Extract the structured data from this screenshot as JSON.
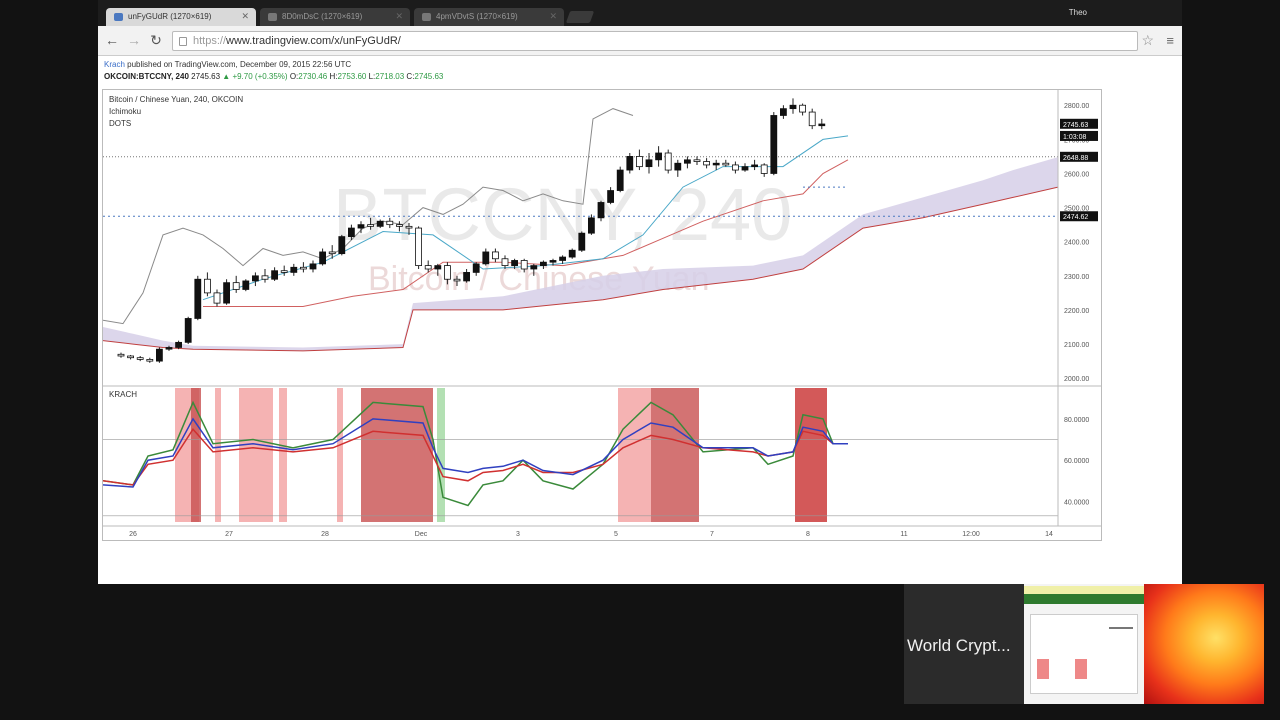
{
  "tabs": [
    {
      "label": "unFyGUdR (1270×619)",
      "active": true
    },
    {
      "label": "8D0mDsC (1270×619)",
      "active": false
    },
    {
      "label": "4pmVDvtS (1270×619)",
      "active": false
    }
  ],
  "user": "Theo",
  "url": {
    "scheme": "https://",
    "rest": "www.tradingview.com/x/unFyGUdR/"
  },
  "published": {
    "author": "Krach",
    "text": " published on TradingView.com, December 09, 2015 22:56 UTC"
  },
  "ohlc": {
    "symbol": "OKCOIN:BTCCNY, 240",
    "last": "2745.63",
    "change": "▲ +9.70 (+0.35%)",
    "o_label": "O:",
    "o": "2730.46",
    "h_label": "H:",
    "h": "2753.60",
    "l_label": "L:",
    "l": "2718.03",
    "c_label": "C:",
    "c": "2745.63"
  },
  "chart_legend": {
    "title": "Bitcoin / Chinese Yuan, 240, OKCOIN",
    "ind1": "Ichimoku",
    "ind2": "DOTS",
    "watermark_main": "BTCCNY, 240",
    "watermark_sub": "Bitcoin / Chinese Yuan",
    "lower_label": "KRACH"
  },
  "price_axis": {
    "ticks": [
      "2800.00",
      "2700.00",
      "2600.00",
      "2500.00",
      "2400.00",
      "2300.00",
      "2200.00",
      "2100.00",
      "2000.00"
    ],
    "badges": [
      {
        "text": "2745.63",
        "price": 2745.63
      },
      {
        "text": "1:03:08",
        "price": 2710
      },
      {
        "text": "2648.88",
        "price": 2648.88
      },
      {
        "text": "2474.62",
        "price": 2474.62
      }
    ]
  },
  "lower_axis": {
    "ticks": [
      "80.0000",
      "60.0000",
      "40.0000"
    ]
  },
  "time_axis": [
    "26",
    "27",
    "28",
    "Dec",
    "3",
    "5",
    "7",
    "8",
    "11",
    "12:00",
    "14"
  ],
  "chart_data": {
    "type": "candlestick",
    "price_range": [
      1980,
      2830
    ],
    "candles": [
      [
        2070,
        2075,
        2060,
        2065
      ],
      [
        2065,
        2068,
        2055,
        2060
      ],
      [
        2060,
        2065,
        2050,
        2055
      ],
      [
        2055,
        2060,
        2045,
        2050
      ],
      [
        2050,
        2090,
        2045,
        2085
      ],
      [
        2085,
        2095,
        2080,
        2090
      ],
      [
        2090,
        2110,
        2085,
        2105
      ],
      [
        2105,
        2180,
        2100,
        2175
      ],
      [
        2175,
        2300,
        2170,
        2290
      ],
      [
        2290,
        2310,
        2240,
        2250
      ],
      [
        2250,
        2260,
        2210,
        2220
      ],
      [
        2220,
        2290,
        2215,
        2280
      ],
      [
        2280,
        2300,
        2250,
        2260
      ],
      [
        2260,
        2290,
        2255,
        2285
      ],
      [
        2285,
        2310,
        2270,
        2300
      ],
      [
        2300,
        2320,
        2280,
        2290
      ],
      [
        2290,
        2325,
        2285,
        2315
      ],
      [
        2315,
        2330,
        2300,
        2310
      ],
      [
        2310,
        2335,
        2300,
        2325
      ],
      [
        2325,
        2340,
        2310,
        2320
      ],
      [
        2320,
        2345,
        2310,
        2335
      ],
      [
        2335,
        2380,
        2330,
        2370
      ],
      [
        2370,
        2390,
        2350,
        2365
      ],
      [
        2365,
        2420,
        2360,
        2415
      ],
      [
        2415,
        2450,
        2405,
        2440
      ],
      [
        2440,
        2460,
        2425,
        2450
      ],
      [
        2450,
        2470,
        2435,
        2445
      ],
      [
        2445,
        2465,
        2440,
        2460
      ],
      [
        2460,
        2470,
        2440,
        2450
      ],
      [
        2450,
        2460,
        2430,
        2445
      ],
      [
        2445,
        2455,
        2420,
        2440
      ],
      [
        2440,
        2445,
        2320,
        2330
      ],
      [
        2330,
        2345,
        2310,
        2320
      ],
      [
        2320,
        2335,
        2300,
        2330
      ],
      [
        2330,
        2340,
        2275,
        2290
      ],
      [
        2290,
        2300,
        2270,
        2285
      ],
      [
        2285,
        2320,
        2280,
        2310
      ],
      [
        2310,
        2340,
        2300,
        2335
      ],
      [
        2335,
        2380,
        2330,
        2370
      ],
      [
        2370,
        2380,
        2340,
        2350
      ],
      [
        2350,
        2360,
        2320,
        2330
      ],
      [
        2330,
        2350,
        2320,
        2345
      ],
      [
        2345,
        2350,
        2310,
        2320
      ],
      [
        2320,
        2335,
        2300,
        2330
      ],
      [
        2330,
        2345,
        2320,
        2340
      ],
      [
        2340,
        2350,
        2330,
        2345
      ],
      [
        2345,
        2360,
        2335,
        2355
      ],
      [
        2355,
        2380,
        2350,
        2375
      ],
      [
        2375,
        2430,
        2370,
        2425
      ],
      [
        2425,
        2480,
        2420,
        2470
      ],
      [
        2470,
        2520,
        2460,
        2515
      ],
      [
        2515,
        2560,
        2510,
        2550
      ],
      [
        2550,
        2620,
        2545,
        2610
      ],
      [
        2610,
        2660,
        2600,
        2650
      ],
      [
        2650,
        2670,
        2610,
        2620
      ],
      [
        2620,
        2660,
        2600,
        2640
      ],
      [
        2640,
        2680,
        2620,
        2660
      ],
      [
        2660,
        2670,
        2600,
        2610
      ],
      [
        2610,
        2640,
        2590,
        2630
      ],
      [
        2630,
        2650,
        2615,
        2640
      ],
      [
        2640,
        2650,
        2625,
        2635
      ],
      [
        2635,
        2645,
        2615,
        2625
      ],
      [
        2625,
        2640,
        2610,
        2630
      ],
      [
        2630,
        2640,
        2620,
        2625
      ],
      [
        2625,
        2635,
        2600,
        2610
      ],
      [
        2610,
        2630,
        2605,
        2620
      ],
      [
        2620,
        2640,
        2610,
        2625
      ],
      [
        2625,
        2630,
        2590,
        2600
      ],
      [
        2600,
        2780,
        2595,
        2770
      ],
      [
        2770,
        2800,
        2760,
        2790
      ],
      [
        2790,
        2820,
        2775,
        2800
      ],
      [
        2800,
        2805,
        2770,
        2780
      ],
      [
        2780,
        2790,
        2730,
        2740
      ],
      [
        2740,
        2760,
        2730,
        2745
      ]
    ]
  }
}
